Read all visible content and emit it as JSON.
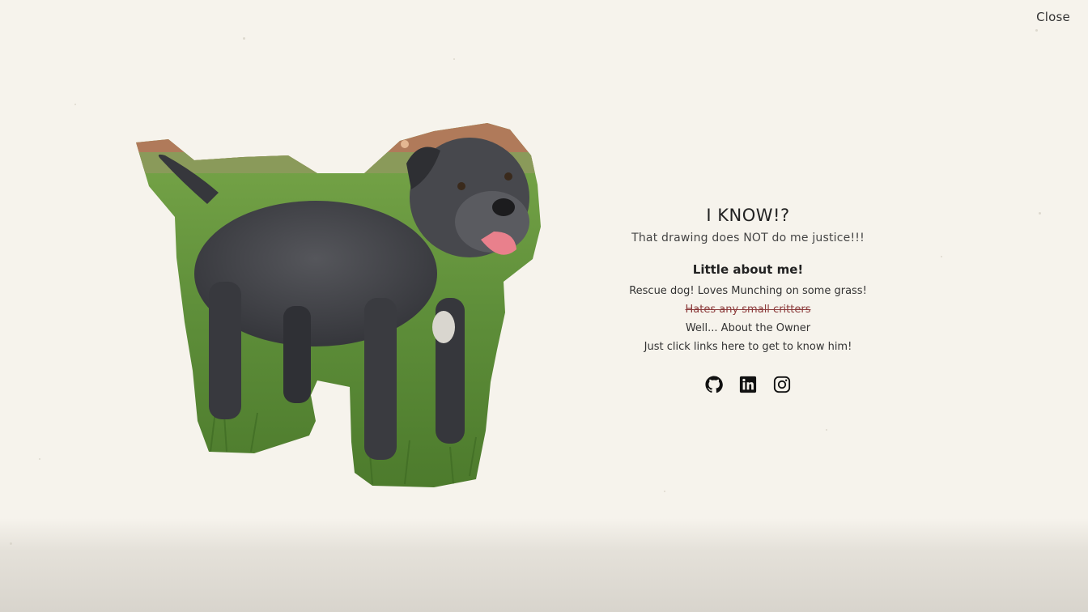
{
  "header": {
    "close_label": "Close"
  },
  "intro": {
    "title": "I KNOW!?",
    "subtitle": "That drawing does NOT do me justice!!!"
  },
  "about": {
    "heading": "Little about me!",
    "lines": [
      "Rescue dog! Loves Munching on some grass!",
      "Hates any small critters",
      "Well... About the Owner",
      "Just click links here to get to know him!"
    ]
  },
  "social": {
    "links": [
      "github-icon",
      "linkedin-icon",
      "instagram-icon"
    ]
  },
  "colors": {
    "background": "#f6f3ec",
    "text": "#222222",
    "strike_text": "#8b3a3a",
    "grass": "#5f8f3a",
    "dog_fur": "#3f4045"
  }
}
